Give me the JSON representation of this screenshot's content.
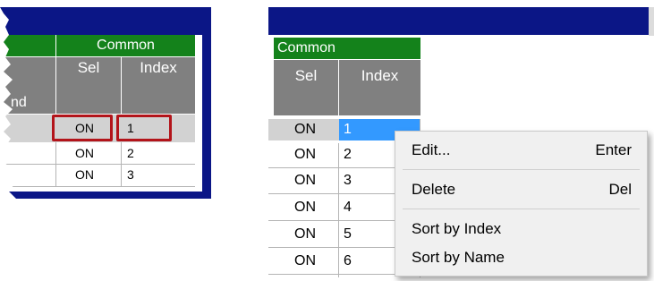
{
  "left_view": {
    "group_header": "Common",
    "col_sel": "Sel",
    "col_index": "Index",
    "cut_label": "nd",
    "rows": [
      {
        "sel": "ON",
        "index": "1"
      },
      {
        "sel": "ON",
        "index": "2"
      },
      {
        "sel": "ON",
        "index": "3"
      }
    ]
  },
  "right_view": {
    "group_header": "Common",
    "col_sel": "Sel",
    "col_index": "Index",
    "rows": [
      {
        "sel": "ON",
        "index": "1"
      },
      {
        "sel": "ON",
        "index": "2"
      },
      {
        "sel": "ON",
        "index": "3"
      },
      {
        "sel": "ON",
        "index": "4"
      },
      {
        "sel": "ON",
        "index": "5"
      },
      {
        "sel": "ON",
        "index": "6"
      }
    ]
  },
  "context_menu": {
    "items": [
      {
        "label": "Edit...",
        "shortcut": "Enter"
      },
      {
        "label": "Delete",
        "shortcut": "Del"
      },
      {
        "label": "Sort by Index",
        "shortcut": ""
      },
      {
        "label": "Sort by Name",
        "shortcut": ""
      }
    ]
  },
  "colors": {
    "title_bar": "#0b1686",
    "group_header": "#14821b",
    "column_header": "#808080",
    "selection": "#3399ff",
    "highlight_box": "#b3141a"
  }
}
